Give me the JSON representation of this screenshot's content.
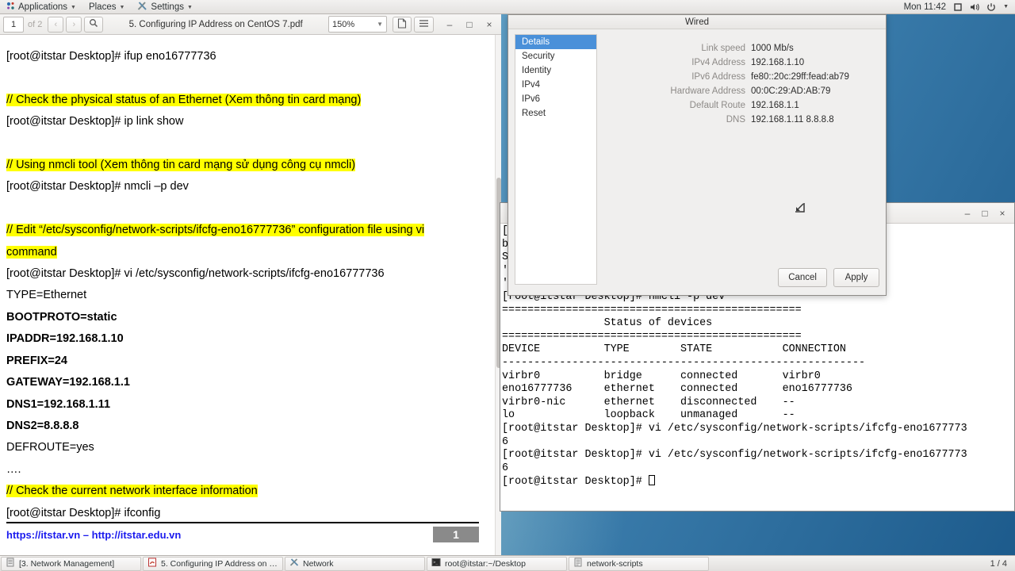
{
  "top_panel": {
    "menus": [
      {
        "label": "Applications",
        "icon": "app-grid-icon"
      },
      {
        "label": "Places",
        "icon": "places-icon"
      },
      {
        "label": "Settings",
        "icon": "settings-tools-icon"
      }
    ],
    "clock": "Mon 11:42",
    "tray": [
      "screen-icon",
      "volume-icon",
      "power-icon",
      "chevron-down-icon"
    ]
  },
  "pdf_viewer": {
    "page_current": "1",
    "page_total": "of 2",
    "prev_label": "‹",
    "next_label": "›",
    "search_icon": "search-icon",
    "title": "5. Configuring IP Address on CentOS 7.pdf",
    "zoom": "150%",
    "view_icon": "page-view-icon",
    "menu_icon": "hamburger-menu-icon",
    "minimize": "–",
    "maximize": "□",
    "close": "×",
    "document": {
      "lines": [
        {
          "text": "[root@itstar Desktop]# ifup eno16777736",
          "style": "plain"
        },
        {
          "text": "",
          "style": "blank"
        },
        {
          "text": "// Check the physical status of an Ethernet (Xem thông tin card mạng)",
          "style": "highlight"
        },
        {
          "text": "[root@itstar Desktop]# ip link show",
          "style": "plain"
        },
        {
          "text": "",
          "style": "blank"
        },
        {
          "text": "// Using nmcli tool (Xem thông tin card mạng sử dụng công cụ nmcli)",
          "style": "highlight"
        },
        {
          "text": "[root@itstar Desktop]# nmcli –p dev",
          "style": "plain"
        },
        {
          "text": "",
          "style": "blank"
        },
        {
          "text": "//   Edit   “/etc/sysconfig/network-scripts/ifcfg-eno16777736”   configuration   file   using   vi",
          "style": "highlight-justify"
        },
        {
          "text": "command",
          "style": "highlight"
        },
        {
          "text": "[root@itstar Desktop]# vi /etc/sysconfig/network-scripts/ifcfg-eno16777736",
          "style": "plain"
        },
        {
          "text": "TYPE=Ethernet",
          "style": "plain"
        },
        {
          "text": "BOOTPROTO=static",
          "style": "bold"
        },
        {
          "text": "IPADDR=192.168.1.10",
          "style": "bold"
        },
        {
          "text": "PREFIX=24",
          "style": "bold"
        },
        {
          "text": "GATEWAY=192.168.1.1",
          "style": "bold"
        },
        {
          "text": "DNS1=192.168.1.11",
          "style": "bold"
        },
        {
          "text": "DNS2=8.8.8.8",
          "style": "bold"
        },
        {
          "text": "DEFROUTE=yes",
          "style": "plain"
        },
        {
          "text": "….",
          "style": "plain"
        },
        {
          "text": "// Check the current network interface information",
          "style": "highlight"
        },
        {
          "text": "[root@itstar Desktop]# ifconfig",
          "style": "plain"
        }
      ],
      "footer_link": "https://itstar.vn – http://itstar.edu.vn",
      "footer_page": "1"
    }
  },
  "terminal": {
    "minimize": "–",
    "maximize": "□",
    "close": "×",
    "lines": [
      "[",
      "b",
      "S",
      "'",
      "'nmcli'",
      "[root@itstar Desktop]# nmcli -p dev",
      "===============================================",
      "                Status of devices",
      "===============================================",
      "DEVICE          TYPE        STATE           CONNECTION",
      "---------------------------------------------------------",
      "virbr0          bridge      connected       virbr0",
      "eno16777736     ethernet    connected       eno16777736",
      "virbr0-nic      ethernet    disconnected    --",
      "lo              loopback    unmanaged       --",
      "[root@itstar Desktop]# vi /etc/sysconfig/network-scripts/ifcfg-eno1677773",
      "6",
      "[root@itstar Desktop]# vi /etc/sysconfig/network-scripts/ifcfg-eno1677773",
      "6",
      "[root@itstar Desktop]# "
    ]
  },
  "wired_dialog": {
    "title": "Wired",
    "sidebar": [
      {
        "label": "Details",
        "selected": true
      },
      {
        "label": "Security",
        "selected": false
      },
      {
        "label": "Identity",
        "selected": false
      },
      {
        "label": "IPv4",
        "selected": false
      },
      {
        "label": "IPv6",
        "selected": false
      },
      {
        "label": "Reset",
        "selected": false
      }
    ],
    "details": [
      {
        "key": "Link speed",
        "value": "1000 Mb/s"
      },
      {
        "key": "IPv4 Address",
        "value": "192.168.1.10"
      },
      {
        "key": "IPv6 Address",
        "value": "fe80::20c:29ff:fead:ab79"
      },
      {
        "key": "Hardware Address",
        "value": "00:0C:29:AD:AB:79"
      },
      {
        "key": "Default Route",
        "value": "192.168.1.1"
      },
      {
        "key": "DNS",
        "value": "192.168.1.11 8.8.8.8"
      }
    ],
    "resize_icon": "resize-down-left-icon",
    "cancel_label": "Cancel",
    "apply_label": "Apply",
    "accent_color": "#4a90d9"
  },
  "taskbar": {
    "items": [
      {
        "label": "[3. Network Management]",
        "icon": "document-icon"
      },
      {
        "label": "5. Configuring IP Address on Cent...",
        "icon": "pdf-icon"
      },
      {
        "label": "Network",
        "icon": "settings-tools-icon"
      },
      {
        "label": "root@itstar:~/Desktop",
        "icon": "terminal-icon"
      },
      {
        "label": "network-scripts",
        "icon": "folder-document-icon"
      }
    ],
    "workspace": "1 / 4"
  }
}
